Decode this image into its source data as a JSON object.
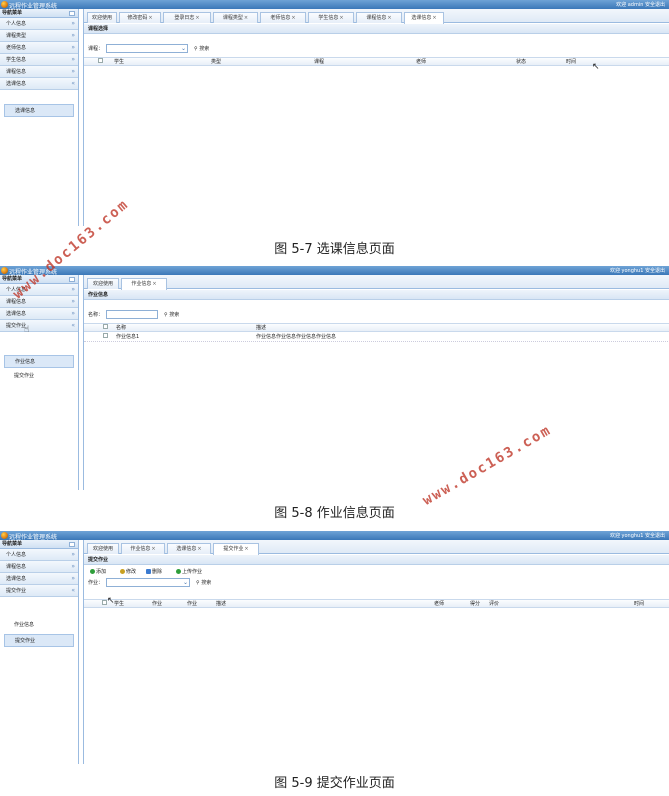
{
  "system_name": "远程作业管理系统",
  "nav_title": "导航菜单",
  "search_label": "搜索",
  "shot1": {
    "user_text": "欢迎 admin 安全退出",
    "groups": [
      "个人信息",
      "课程类型",
      "老师信息",
      "学生信息",
      "课程信息",
      "选课信息"
    ],
    "sub_items": [
      "选课信息"
    ],
    "tabs": [
      "欢迎使用",
      "修改密码",
      "登录日志",
      "课程类型",
      "老师信息",
      "学生信息",
      "课程信息",
      "选课信息"
    ],
    "panel_title": "课程选择",
    "filter_label": "课程：",
    "columns": [
      "学生",
      "类型",
      "课程",
      "老师",
      "状态",
      "时间"
    ],
    "caption": "图 5-7 选课信息页面"
  },
  "shot2": {
    "user_text": "欢迎 yonghu1 安全退出",
    "groups": [
      "个人信息",
      "课程信息",
      "选课信息",
      "提交作业"
    ],
    "sub_items": [
      "作业信息",
      "提交作业"
    ],
    "tabs": [
      "欢迎使用",
      "作业信息"
    ],
    "panel_title": "作业信息",
    "filter_label": "名称：",
    "columns": [
      "名称",
      "描述"
    ],
    "rows": [
      {
        "name": "作业信息1",
        "desc": "作业信息作业信息作业信息作业信息"
      }
    ],
    "caption": "图 5-8 作业信息页面"
  },
  "shot3": {
    "user_text": "欢迎 yonghu1 安全退出",
    "groups": [
      "个人信息",
      "课程信息",
      "选课信息",
      "提交作业"
    ],
    "sub_items": [
      "作业信息",
      "提交作业"
    ],
    "tabs": [
      "欢迎使用",
      "作业信息",
      "选课信息",
      "提交作业"
    ],
    "panel_title": "提交作业",
    "buttons": [
      "添加",
      "修改",
      "删除",
      "上传作业"
    ],
    "button_colors": [
      "#2e9e3a",
      "#c9a020",
      "#3a7ad0",
      "#2e9e3a"
    ],
    "filter_label": "作业：",
    "columns": [
      "学生",
      "作业",
      "作业",
      "描述",
      "老师",
      "得分",
      "评价",
      "时间"
    ],
    "caption": "图 5-9 提交作业页面"
  },
  "watermark": "www.doc163.com"
}
